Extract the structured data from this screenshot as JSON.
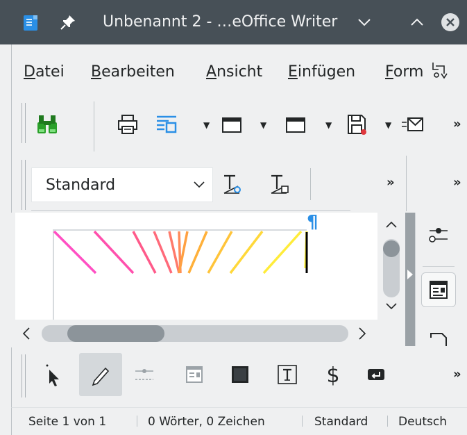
{
  "window": {
    "title": "Unbenannt 2 - …eOffice Writer",
    "app_icon": "writer-document-icon",
    "pin_icon": "pin-icon",
    "minimize_icon": "chevron-down-icon",
    "maximize_icon": "chevron-up-icon",
    "close_icon": "close-icon"
  },
  "menubar": {
    "items": [
      {
        "first": "D",
        "rest": "atei"
      },
      {
        "first": "B",
        "rest": "earbeiten"
      },
      {
        "first": "A",
        "rest": "nsicht"
      },
      {
        "first": "E",
        "rest": "infügen"
      },
      {
        "first": "F",
        "rest": "orm"
      }
    ],
    "overflow_icon": "menu-overflow-icon"
  },
  "toolbar_standard": {
    "icons": [
      "find-binoculars-icon",
      "print-icon",
      "toggle-view-icon",
      "open-icon",
      "templates-icon",
      "save-icon",
      "email-icon"
    ],
    "more": "»"
  },
  "toolbar_formatting": {
    "paragraph_style": "Standard",
    "icons": [
      "update-style-icon",
      "new-style-icon"
    ],
    "more": "»",
    "more2": "»"
  },
  "document": {
    "pilcrow": "¶",
    "drawing_line_colors": [
      "#ff4fc3",
      "#ff5a8a",
      "#ff7a5a",
      "#ffb03a",
      "#ffd23a",
      "#fff23a"
    ]
  },
  "sidebar": {
    "icons": [
      "properties-icon",
      "page-icon",
      "styles-icon"
    ]
  },
  "toolbar_drawing": {
    "icons": [
      "select-arrow-icon",
      "freeform-line-icon",
      "line-connector-icon",
      "frame-icon",
      "rectangle-icon",
      "text-box-icon",
      "currency-symbol-icon",
      "insert-line-break-icon"
    ],
    "active": "freeform-line-icon",
    "more": "»"
  },
  "statusbar": {
    "page": "Seite 1 von 1",
    "words": "0 Wörter, 0 Zeichen",
    "page_style": "Standard",
    "language": "Deutsch"
  }
}
